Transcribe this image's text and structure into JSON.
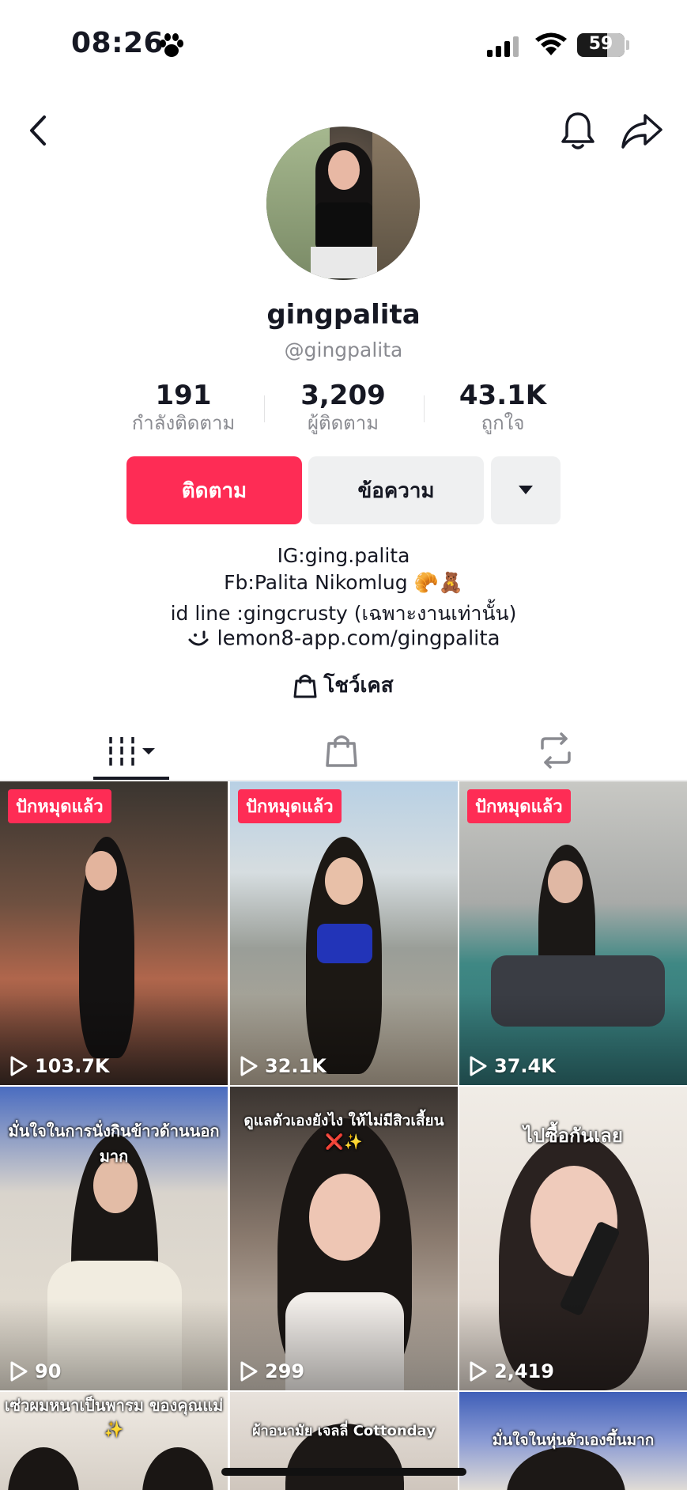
{
  "status_bar": {
    "time": "08:26",
    "battery": "59"
  },
  "profile": {
    "display_name": "gingpalita",
    "handle": "@gingpalita",
    "stats": [
      {
        "value": "191",
        "label": "กำลังติดตาม"
      },
      {
        "value": "3,209",
        "label": "ผู้ติดตาม"
      },
      {
        "value": "43.1K",
        "label": "ถูกใจ"
      }
    ],
    "follow_label": "ติดตาม",
    "message_label": "ข้อความ",
    "bio": [
      "IG:ging.palita",
      "Fb:Palita Nikomlug 🥐🧸",
      "id line :gingcrusty  (เฉพาะงานเท่านั้น)"
    ],
    "link": "lemon8-app.com/gingpalita",
    "showcase_label": "โชว์เคส"
  },
  "videos": [
    {
      "pinned": "ปักหมุดแล้ว",
      "views": "103.7K",
      "caption": ""
    },
    {
      "pinned": "ปักหมุดแล้ว",
      "views": "32.1K",
      "caption": ""
    },
    {
      "pinned": "ปักหมุดแล้ว",
      "views": "37.4K",
      "caption": ""
    },
    {
      "pinned": "",
      "views": "90",
      "caption": "มั่นใจในการนั่งกินข้าวด้านนอกมาก"
    },
    {
      "pinned": "",
      "views": "299",
      "caption": "ดูแลตัวเองยังไง ให้ไม่มีสิวเสี้ยน ❌✨"
    },
    {
      "pinned": "",
      "views": "2,419",
      "caption": "ไปซื้อกันเลย"
    },
    {
      "pinned": "",
      "views": "",
      "caption": "เซ่วผมหนาเป็นพารม ของคุณแม่ ✨"
    },
    {
      "pinned": "",
      "views": "",
      "caption": "ผ้าอนามัย เจลลี่ Cottonday"
    },
    {
      "pinned": "",
      "views": "",
      "caption": "มั่นใจในหุ่นตัวเองขึ้นมาก"
    }
  ],
  "colors": {
    "accent": "#fe2c55",
    "secondary_button": "#eff0f1",
    "muted_text": "#8a8b91"
  }
}
